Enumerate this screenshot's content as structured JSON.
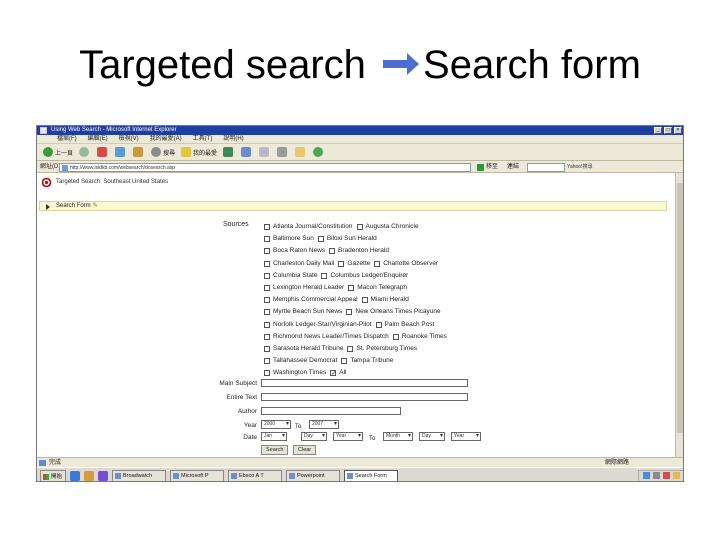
{
  "slide": {
    "title_left": "Targeted search",
    "title_right": "Search form"
  },
  "browser": {
    "window_title": "Using Web Search - Microsoft Internet Explorer",
    "menu": [
      "檔案(F)",
      "編輯(E)",
      "檢視(V)",
      "我的最愛(A)",
      "工具(T)",
      "說明(H)"
    ],
    "toolbar": {
      "back_label": "上一頁",
      "search_label": "搜尋",
      "favorites_label": "我的最愛"
    },
    "address_label": "網址(D)",
    "address_value": "http://www.isidkb.com/websearch/dosearch.asp",
    "go_label": "移至",
    "links_label": "連結",
    "search_dropdown": "Yahoo!搜尋"
  },
  "page": {
    "header_text": "Targeted Search: Southeast United States",
    "section_title": "Search Form",
    "sources_label": "Sources",
    "sources_rows": [
      [
        "Atlanta Journal/Constitution",
        "Augusta Chronicle"
      ],
      [
        "Baltimore Sun",
        "Biloxi Sun Herald"
      ],
      [
        "Boca Raton News",
        "Bradenton Herald"
      ],
      [
        "Charleston Daily Mail",
        "Gazette",
        "Charlotte Observer"
      ],
      [
        "Columbia State",
        "Columbus Ledger/Enquirer"
      ],
      [
        "Lexington Herald Leader",
        "Macon Telegraph"
      ],
      [
        "Memphis Commercial Appeal",
        "Miami Herald"
      ],
      [
        "Myrtle Beach Sun News",
        "New Orleans Times Picayune"
      ],
      [
        "Norfolk Ledger-Star/Virginian-Pilot",
        "Palm Beach Post"
      ],
      [
        "Richmond News Leader/Times Dispatch",
        "Roanoke Times"
      ],
      [
        "Sarasota Herald Tribune",
        "St. Petersburg Times"
      ],
      [
        "Tallahassee Democrat",
        "Tampa Tribune"
      ],
      [
        "Washington Times",
        "All"
      ]
    ],
    "fields": {
      "main_subject_label": "Main Subject",
      "entire_text_label": "Entire Text",
      "author_label": "Author",
      "year_label": "Year",
      "date_label": "Date",
      "to_label": "To",
      "year_from": "2000",
      "year_to": "2007",
      "date_from_month": "Jan",
      "date_from_day": "Day",
      "date_from_year": "Year",
      "date_to_month": "Month",
      "date_to_day": "Day",
      "date_to_year": "Year",
      "search_button": "Search",
      "clear_button": "Clear"
    }
  },
  "status": {
    "left_text": "完成",
    "zone_text": "網際網路"
  },
  "taskbar": {
    "start_label": "開始",
    "tasks": [
      "Broadwatch",
      "Microsoft P",
      "Ebsco A T",
      "Powerpoint",
      "Search Form"
    ],
    "active_task_index": 4
  },
  "colors": {
    "titlebar": "#1f3fa0",
    "chrome": "#ece9d8",
    "section_bar": "#fafad2",
    "arrow": "#4a6fd0"
  }
}
